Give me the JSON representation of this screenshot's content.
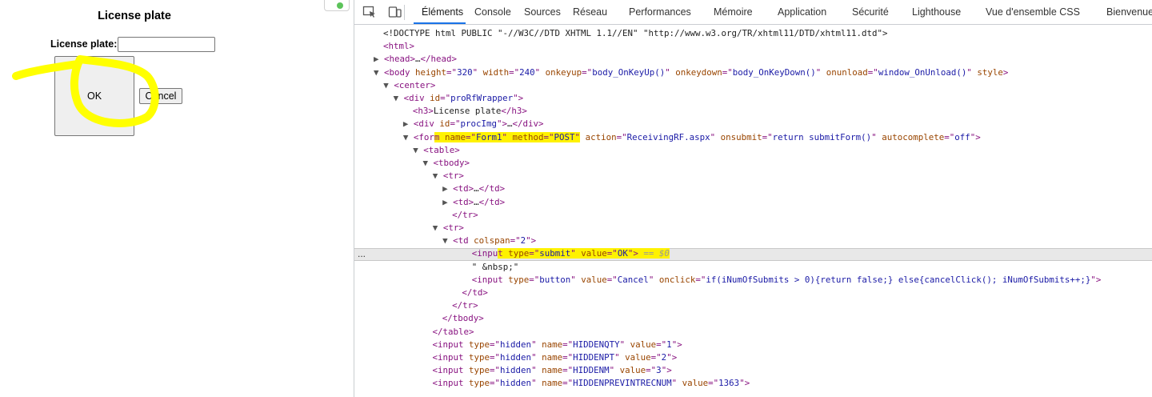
{
  "page": {
    "title": "License plate",
    "field_label": "License plate:",
    "field_value": "",
    "ok_label": "OK",
    "cancel_label": "Cancel",
    "annotation_color": "#ffff00",
    "status_dot_color": "#5cc35a"
  },
  "devtools": {
    "tabs": [
      "Éléments",
      "Console",
      "Sources",
      "Réseau",
      "Performances",
      "Mémoire",
      "Application",
      "Sécurité",
      "Lighthouse",
      "Vue d'ensemble CSS",
      "Bienvenue"
    ],
    "active_tab": "Éléments",
    "accent_color": "#1a73e8",
    "highlight_color": "#fff200",
    "selected_marker": "...",
    "dom_lines": [
      {
        "indent": 0,
        "tri": "",
        "parts": [
          [
            "tx",
            "<!DOCTYPE html PUBLIC \"-//W3C//DTD XHTML 1.1//EN\" \"http://www.w3.org/TR/xhtml11/DTD/xhtml11.dtd\">"
          ]
        ]
      },
      {
        "indent": 0,
        "tri": "",
        "parts": [
          [
            "tag",
            "<html>"
          ]
        ]
      },
      {
        "indent": 0,
        "tri": "▶",
        "parts": [
          [
            "tag",
            "<head>"
          ],
          [
            "tx",
            "…"
          ],
          [
            "tag",
            "</head>"
          ]
        ]
      },
      {
        "indent": 0,
        "tri": "▼",
        "parts": [
          [
            "tag",
            "<body "
          ],
          [
            "an",
            "height"
          ],
          [
            "tag",
            "=\""
          ],
          [
            "av",
            "320"
          ],
          [
            "tag",
            "\" "
          ],
          [
            "an",
            "width"
          ],
          [
            "tag",
            "=\""
          ],
          [
            "av",
            "240"
          ],
          [
            "tag",
            "\" "
          ],
          [
            "an",
            "onkeyup"
          ],
          [
            "tag",
            "=\""
          ],
          [
            "av",
            "body_OnKeyUp()"
          ],
          [
            "tag",
            "\" "
          ],
          [
            "an",
            "onkeydown"
          ],
          [
            "tag",
            "=\""
          ],
          [
            "av",
            "body_OnKeyDown()"
          ],
          [
            "tag",
            "\" "
          ],
          [
            "an",
            "onunload"
          ],
          [
            "tag",
            "=\""
          ],
          [
            "av",
            "window_OnUnload()"
          ],
          [
            "tag",
            "\" "
          ],
          [
            "an",
            "style"
          ],
          [
            "tag",
            ">"
          ]
        ]
      },
      {
        "indent": 1,
        "tri": "▼",
        "parts": [
          [
            "tag",
            "<center>"
          ]
        ]
      },
      {
        "indent": 2,
        "tri": "▼",
        "parts": [
          [
            "tag",
            "<div "
          ],
          [
            "an",
            "id"
          ],
          [
            "tag",
            "=\""
          ],
          [
            "av",
            "proRfWrapper"
          ],
          [
            "tag",
            "\">"
          ]
        ]
      },
      {
        "indent": 3,
        "tri": "",
        "parts": [
          [
            "tag",
            "<h3>"
          ],
          [
            "tx",
            "License plate"
          ],
          [
            "tag",
            "</h3>"
          ]
        ]
      },
      {
        "indent": 3,
        "tri": "▶",
        "parts": [
          [
            "tag",
            "<div "
          ],
          [
            "an",
            "id"
          ],
          [
            "tag",
            "=\""
          ],
          [
            "av",
            "procImg"
          ],
          [
            "tag",
            "\">"
          ],
          [
            "tx",
            "…"
          ],
          [
            "tag",
            "</div>"
          ]
        ]
      },
      {
        "indent": 3,
        "tri": "▼",
        "parts": [
          [
            "tag",
            "<for"
          ],
          [
            "taghl",
            "m "
          ],
          [
            "anhl",
            "name"
          ],
          [
            "taghl",
            "=\""
          ],
          [
            "avhl",
            "Form1"
          ],
          [
            "taghl",
            "\" "
          ],
          [
            "anhl",
            "method"
          ],
          [
            "taghl",
            "=\""
          ],
          [
            "avhl",
            "POST"
          ],
          [
            "taghl",
            "\""
          ],
          [
            "tag",
            " "
          ],
          [
            "an",
            "action"
          ],
          [
            "tag",
            "=\""
          ],
          [
            "av",
            "ReceivingRF.aspx"
          ],
          [
            "tag",
            "\" "
          ],
          [
            "an",
            "onsubmit"
          ],
          [
            "tag",
            "=\""
          ],
          [
            "av",
            "return submitForm()"
          ],
          [
            "tag",
            "\" "
          ],
          [
            "an",
            "autocomplete"
          ],
          [
            "tag",
            "=\""
          ],
          [
            "av",
            "off"
          ],
          [
            "tag",
            "\">"
          ]
        ]
      },
      {
        "indent": 4,
        "tri": "▼",
        "parts": [
          [
            "tag",
            "<table>"
          ]
        ]
      },
      {
        "indent": 5,
        "tri": "▼",
        "parts": [
          [
            "tag",
            "<tbody>"
          ]
        ]
      },
      {
        "indent": 6,
        "tri": "▼",
        "parts": [
          [
            "tag",
            "<tr>"
          ]
        ]
      },
      {
        "indent": 7,
        "tri": "▶",
        "parts": [
          [
            "tag",
            "<td>"
          ],
          [
            "tx",
            "…"
          ],
          [
            "tag",
            "</td>"
          ]
        ]
      },
      {
        "indent": 7,
        "tri": "▶",
        "parts": [
          [
            "tag",
            "<td>"
          ],
          [
            "tx",
            "…"
          ],
          [
            "tag",
            "</td>"
          ]
        ]
      },
      {
        "indent": 7,
        "tri": "",
        "parts": [
          [
            "tag",
            "</tr>"
          ]
        ]
      },
      {
        "indent": 6,
        "tri": "▼",
        "parts": [
          [
            "tag",
            "<tr>"
          ]
        ]
      },
      {
        "indent": 7,
        "tri": "▼",
        "parts": [
          [
            "tag",
            "<td "
          ],
          [
            "an",
            "colspan"
          ],
          [
            "tag",
            "=\""
          ],
          [
            "av",
            "2"
          ],
          [
            "tag",
            "\">"
          ]
        ]
      },
      {
        "indent": 9,
        "tri": "",
        "parts": [
          [
            "tag",
            "<inpu"
          ],
          [
            "taghl",
            "t "
          ],
          [
            "anhl",
            "type"
          ],
          [
            "taghl",
            "=\""
          ],
          [
            "avhl",
            "submit"
          ],
          [
            "taghl",
            "\" "
          ],
          [
            "anhl",
            "value"
          ],
          [
            "taghl",
            "=\""
          ],
          [
            "avhl",
            "OK"
          ],
          [
            "taghl",
            "\">"
          ],
          [
            "eq0hl",
            " == $0"
          ]
        ]
      },
      {
        "indent": 9,
        "tri": "",
        "parts": [
          [
            "tx",
            "\" &nbsp;\""
          ]
        ]
      },
      {
        "indent": 9,
        "tri": "",
        "parts": [
          [
            "tag",
            "<input "
          ],
          [
            "an",
            "type"
          ],
          [
            "tag",
            "=\""
          ],
          [
            "av",
            "button"
          ],
          [
            "tag",
            "\" "
          ],
          [
            "an",
            "value"
          ],
          [
            "tag",
            "=\""
          ],
          [
            "av",
            "Cancel"
          ],
          [
            "tag",
            "\" "
          ],
          [
            "an",
            "onclick"
          ],
          [
            "tag",
            "=\""
          ],
          [
            "av",
            "if(iNumOfSubmits > 0){return false;} else{cancelClick(); iNumOfSubmits++;}"
          ],
          [
            "tag",
            "\">"
          ]
        ]
      },
      {
        "indent": 8,
        "tri": "",
        "parts": [
          [
            "tag",
            "</td>"
          ]
        ]
      },
      {
        "indent": 7,
        "tri": "",
        "parts": [
          [
            "tag",
            "</tr>"
          ]
        ]
      },
      {
        "indent": 6,
        "tri": "",
        "parts": [
          [
            "tag",
            "</tbody>"
          ]
        ]
      },
      {
        "indent": 5,
        "tri": "",
        "parts": [
          [
            "tag",
            "</table>"
          ]
        ]
      },
      {
        "indent": 5,
        "tri": "",
        "parts": [
          [
            "tag",
            "<input "
          ],
          [
            "an",
            "type"
          ],
          [
            "tag",
            "=\""
          ],
          [
            "av",
            "hidden"
          ],
          [
            "tag",
            "\" "
          ],
          [
            "an",
            "name"
          ],
          [
            "tag",
            "=\""
          ],
          [
            "av",
            "HIDDENQTY"
          ],
          [
            "tag",
            "\" "
          ],
          [
            "an",
            "value"
          ],
          [
            "tag",
            "=\""
          ],
          [
            "av",
            "1"
          ],
          [
            "tag",
            "\">"
          ]
        ]
      },
      {
        "indent": 5,
        "tri": "",
        "parts": [
          [
            "tag",
            "<input "
          ],
          [
            "an",
            "type"
          ],
          [
            "tag",
            "=\""
          ],
          [
            "av",
            "hidden"
          ],
          [
            "tag",
            "\" "
          ],
          [
            "an",
            "name"
          ],
          [
            "tag",
            "=\""
          ],
          [
            "av",
            "HIDDENPT"
          ],
          [
            "tag",
            "\" "
          ],
          [
            "an",
            "value"
          ],
          [
            "tag",
            "=\""
          ],
          [
            "av",
            "2"
          ],
          [
            "tag",
            "\">"
          ]
        ]
      },
      {
        "indent": 5,
        "tri": "",
        "parts": [
          [
            "tag",
            "<input "
          ],
          [
            "an",
            "type"
          ],
          [
            "tag",
            "=\""
          ],
          [
            "av",
            "hidden"
          ],
          [
            "tag",
            "\" "
          ],
          [
            "an",
            "name"
          ],
          [
            "tag",
            "=\""
          ],
          [
            "av",
            "HIDDENM"
          ],
          [
            "tag",
            "\" "
          ],
          [
            "an",
            "value"
          ],
          [
            "tag",
            "=\""
          ],
          [
            "av",
            "3"
          ],
          [
            "tag",
            "\">"
          ]
        ]
      },
      {
        "indent": 5,
        "tri": "",
        "parts": [
          [
            "tag",
            "<input "
          ],
          [
            "an",
            "type"
          ],
          [
            "tag",
            "=\""
          ],
          [
            "av",
            "hidden"
          ],
          [
            "tag",
            "\" "
          ],
          [
            "an",
            "name"
          ],
          [
            "tag",
            "=\""
          ],
          [
            "av",
            "HIDDENPREVINTRECNUM"
          ],
          [
            "tag",
            "\" "
          ],
          [
            "an",
            "value"
          ],
          [
            "tag",
            "=\""
          ],
          [
            "av",
            "1363"
          ],
          [
            "tag",
            "\">"
          ]
        ]
      }
    ]
  }
}
